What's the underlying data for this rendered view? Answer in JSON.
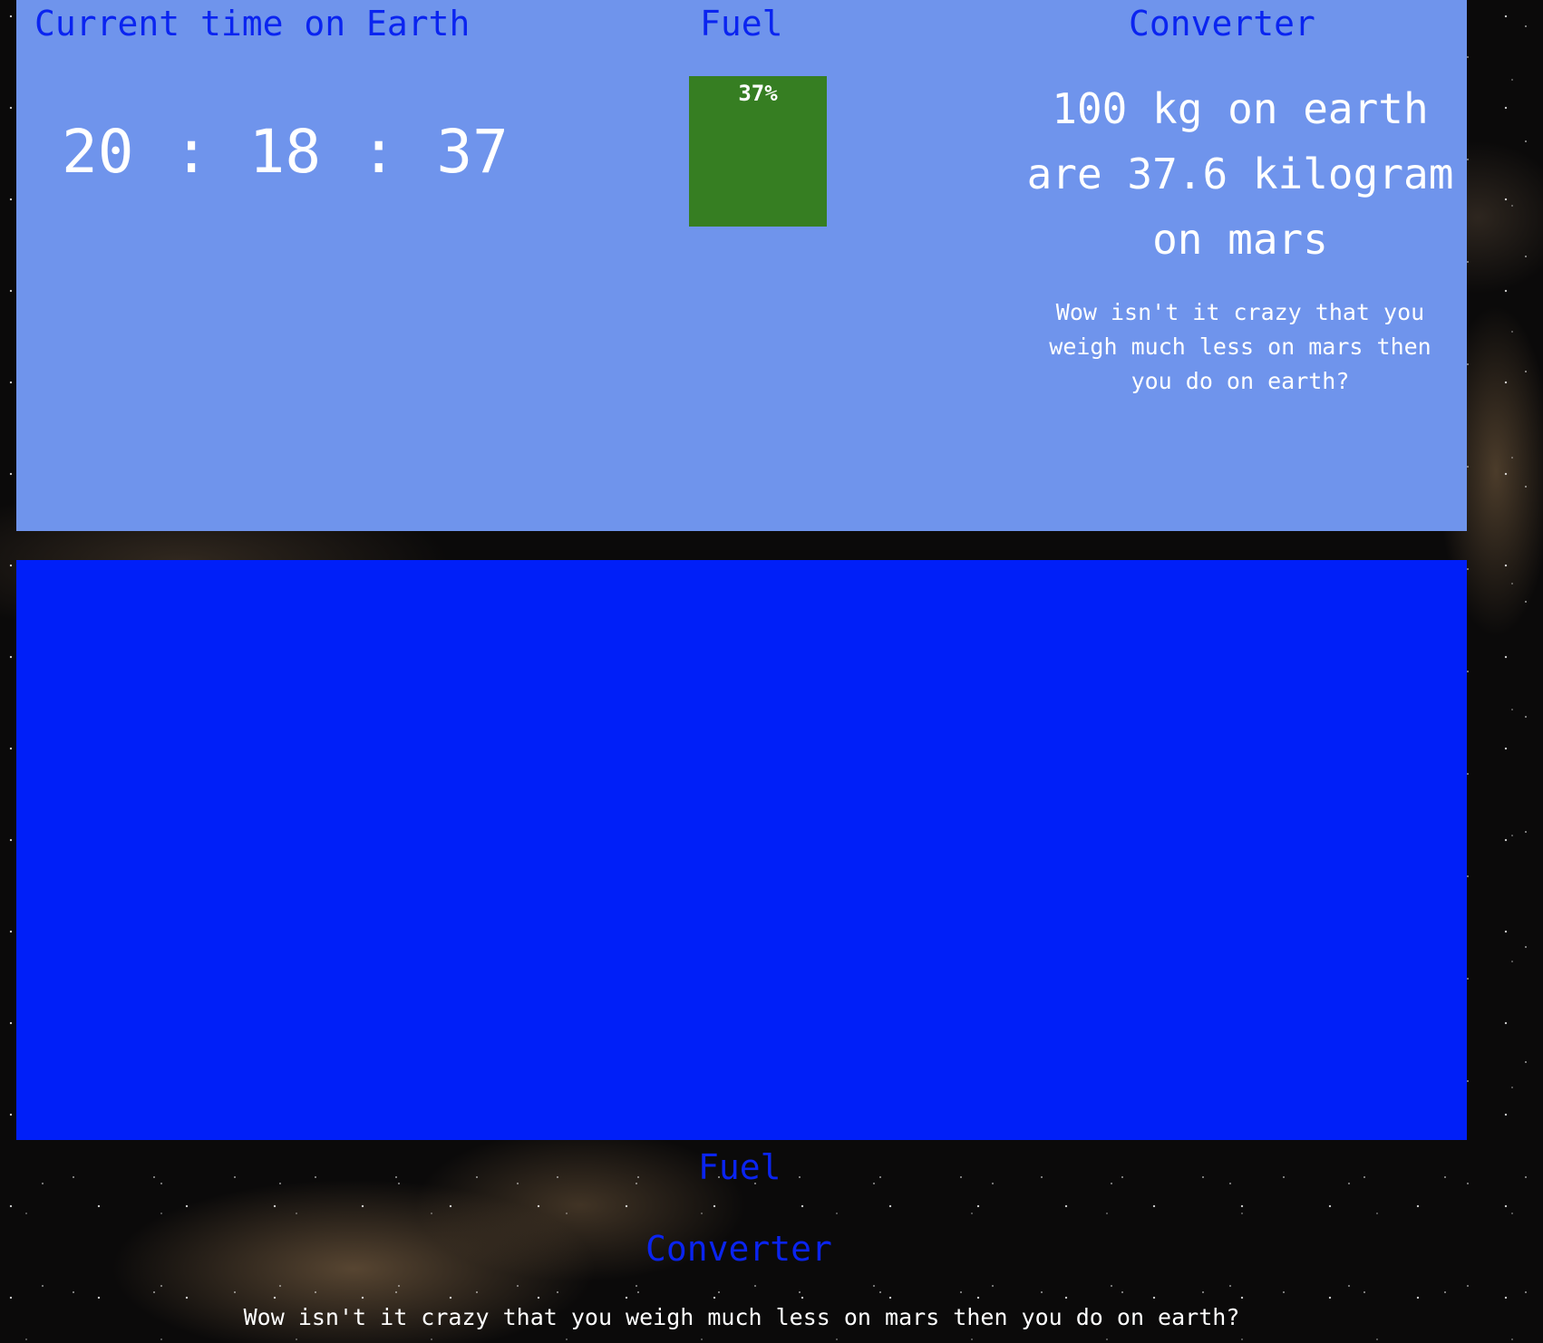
{
  "colors": {
    "panel_light": "#6f94ec",
    "panel_dark": "#001ff8",
    "heading_text": "#0a24f0",
    "fuel_fill": "#367e22",
    "body_text": "#ffffff"
  },
  "top_section": {
    "clock": {
      "heading": "Current time on Earth",
      "time": "20 : 18 : 37"
    },
    "fuel": {
      "heading": "Fuel",
      "percent_label": "37%",
      "level_percent": 37
    },
    "converter": {
      "heading": "Converter",
      "result": "100 kg on earth are 37.6 kilogram on mars",
      "note": "Wow isn't it crazy that you weigh much less on mars then you do on earth?"
    }
  },
  "bottom_section": {
    "fuel_heading": "Fuel",
    "converter_heading": "Converter",
    "converter_note": "Wow isn't it crazy that you weigh much less on mars then you do on earth?"
  }
}
